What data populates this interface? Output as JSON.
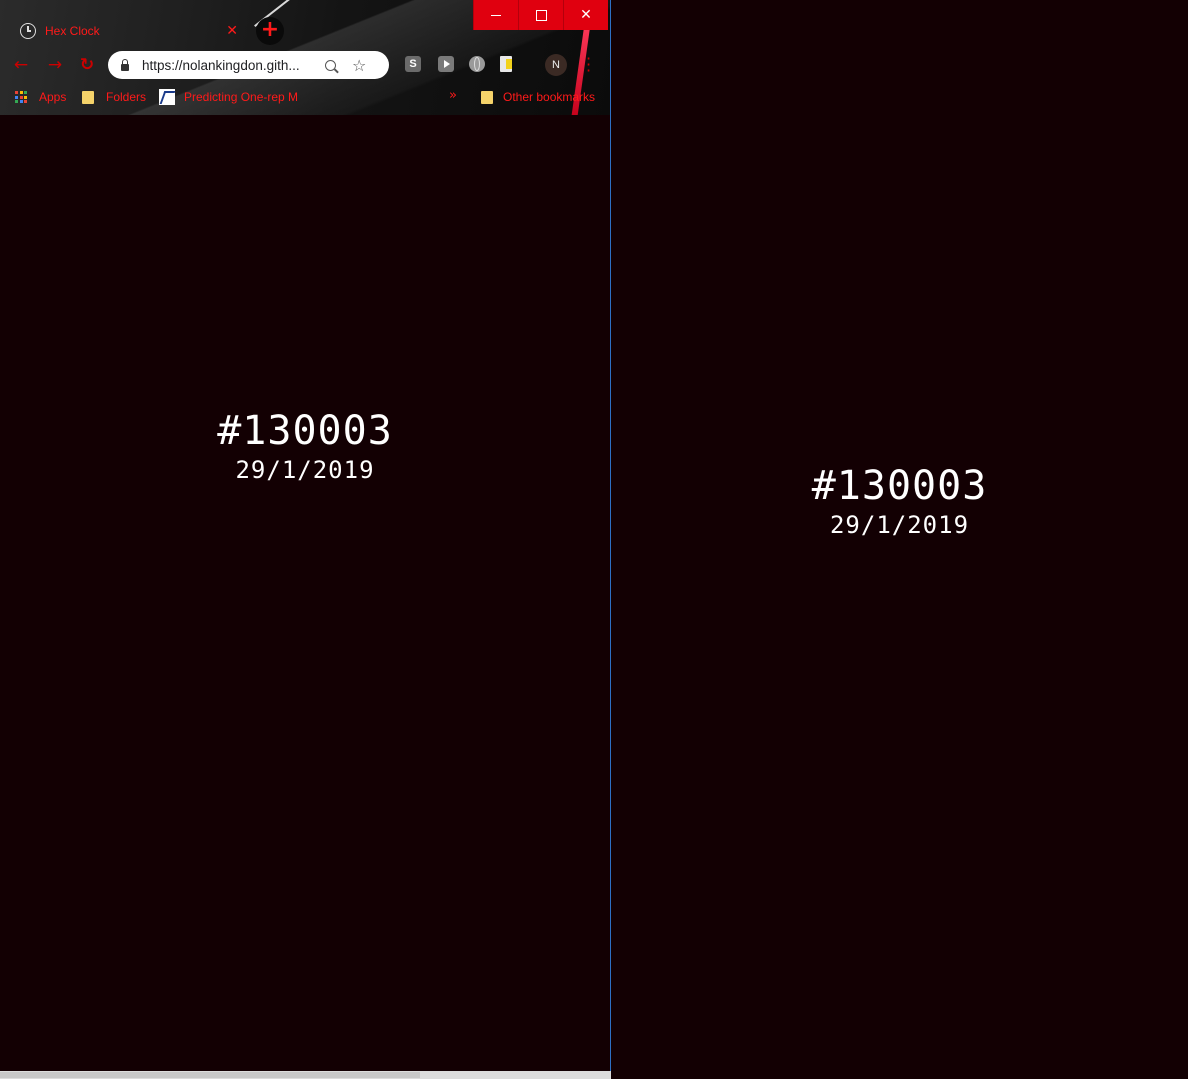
{
  "window": {
    "tab_title": "Hex Clock",
    "tab_close": "✕",
    "new_tab": "+",
    "controls": {
      "minimize": "minimize",
      "maximize": "maximize",
      "close": "✕"
    }
  },
  "toolbar": {
    "back": "←",
    "forward": "→",
    "reload": "↻",
    "url": "https://nolankingdon.gith...",
    "star": "☆",
    "extensions": [
      "S",
      "youtube-icon",
      "globe-icon",
      "doc-icon"
    ],
    "avatar_initial": "N",
    "menu": "⋮"
  },
  "bookmarks": {
    "apps": "Apps",
    "folders": "Folders",
    "predicting": "Predicting One-rep M",
    "overflow": "»",
    "other": "Other bookmarks"
  },
  "clock": {
    "hex": "#130003",
    "date": "29/1/2019",
    "background": "#130003"
  },
  "colors": {
    "accent": "#ff1a1a",
    "window_controls": "#e0000f",
    "text": "#ffffff"
  }
}
